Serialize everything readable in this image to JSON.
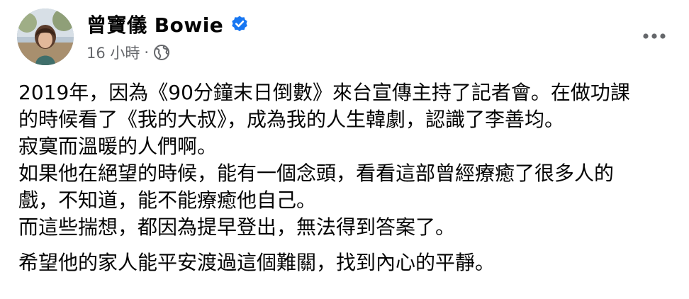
{
  "author": {
    "name": "曾寶儀 Bowie",
    "verified": true
  },
  "meta": {
    "time": "16 小時",
    "separator": "·",
    "audience_icon": "globe-icon"
  },
  "menu": {
    "icon": "more-horizontal-icon"
  },
  "post": {
    "lines": [
      "2019年，因為《90分鐘末日倒數》來台宣傳主持了記者會。在做功課",
      "的時候看了《我的大叔》，成為我的人生韓劇，認識了李善均。",
      "寂寞而溫暖的人們啊。",
      "如果他在絕望的時候，能有一個念頭，看看這部曾經療癒了很多人的",
      "戲，不知道，能不能療癒他自己。",
      "而這些揣想，都因為提早登出，無法得到答案了。"
    ],
    "final_paragraph": "希望他的家人能平安渡過這個難關，找到內心的平靜。"
  },
  "colors": {
    "text_primary": "#050505",
    "text_secondary": "#65676b",
    "verified_blue": "#1877f2",
    "background": "#ffffff"
  }
}
